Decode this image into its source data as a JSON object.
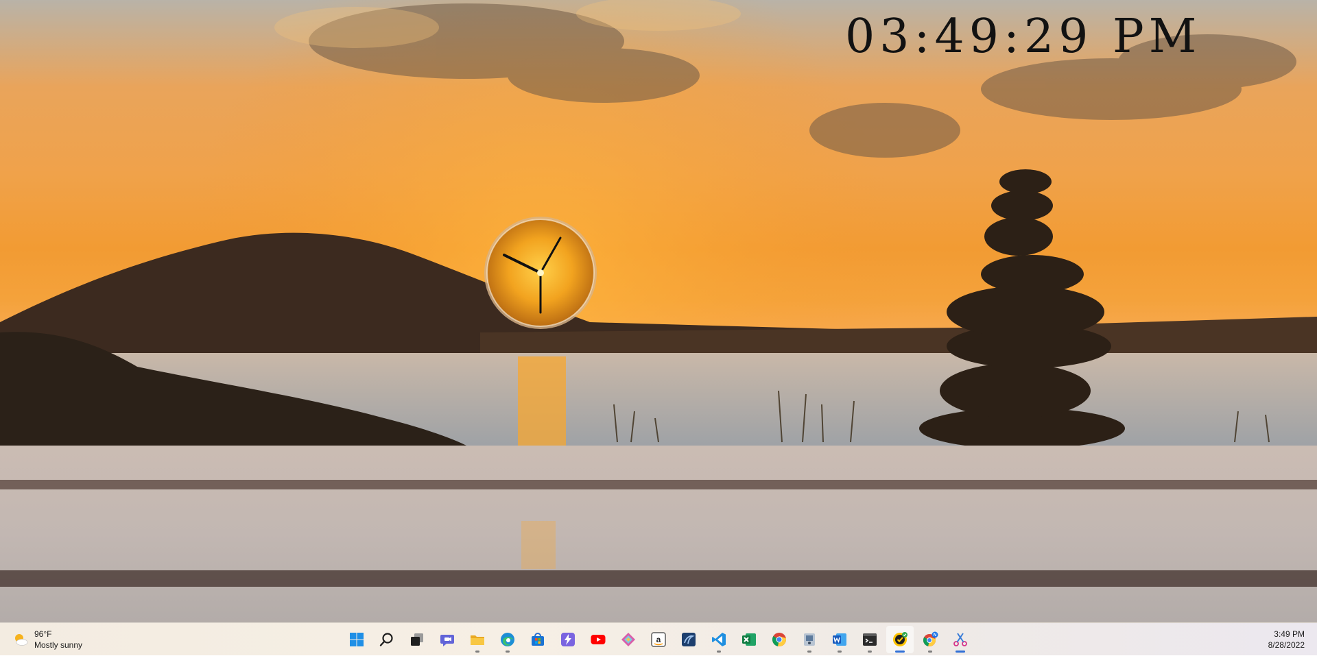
{
  "desktop": {
    "digital_clock_time": "03:49:29 PM"
  },
  "taskbar": {
    "weather": {
      "icon": "sun-cloud-icon",
      "temperature": "96°F",
      "condition": "Mostly sunny"
    },
    "apps": [
      {
        "name": "start-button",
        "icon": "windows-logo-icon"
      },
      {
        "name": "search-button",
        "icon": "search-icon"
      },
      {
        "name": "task-view-button",
        "icon": "task-view-icon"
      },
      {
        "name": "chat-button",
        "icon": "chat-icon"
      },
      {
        "name": "file-explorer-button",
        "icon": "folder-icon"
      },
      {
        "name": "edge-button",
        "icon": "edge-icon"
      },
      {
        "name": "store-button",
        "icon": "store-icon"
      },
      {
        "name": "power-automate-button",
        "icon": "power-automate-icon"
      },
      {
        "name": "youtube-button",
        "icon": "youtube-icon"
      },
      {
        "name": "git-app-button",
        "icon": "diamond-icon"
      },
      {
        "name": "amazon-button",
        "icon": "amazon-icon"
      },
      {
        "name": "sql-server-button",
        "icon": "sql-server-icon"
      },
      {
        "name": "vscode-button",
        "icon": "vscode-icon"
      },
      {
        "name": "excel-button",
        "icon": "excel-icon"
      },
      {
        "name": "chrome-button",
        "icon": "chrome-icon"
      },
      {
        "name": "paint-tool-button",
        "icon": "paint-tool-icon"
      },
      {
        "name": "word-button",
        "icon": "word-icon"
      },
      {
        "name": "terminal-button",
        "icon": "terminal-icon"
      },
      {
        "name": "norton-button",
        "icon": "norton-icon"
      },
      {
        "name": "chrome-profile-button",
        "icon": "chrome-profile-icon",
        "badge": "N"
      },
      {
        "name": "snipping-tool-button",
        "icon": "snipping-tool-icon"
      }
    ],
    "clock": {
      "time": "3:49 PM",
      "date": "8/28/2022"
    }
  },
  "colors": {
    "accent_indicator": "#2f6fd6",
    "clock_face": "#f2a31f"
  }
}
